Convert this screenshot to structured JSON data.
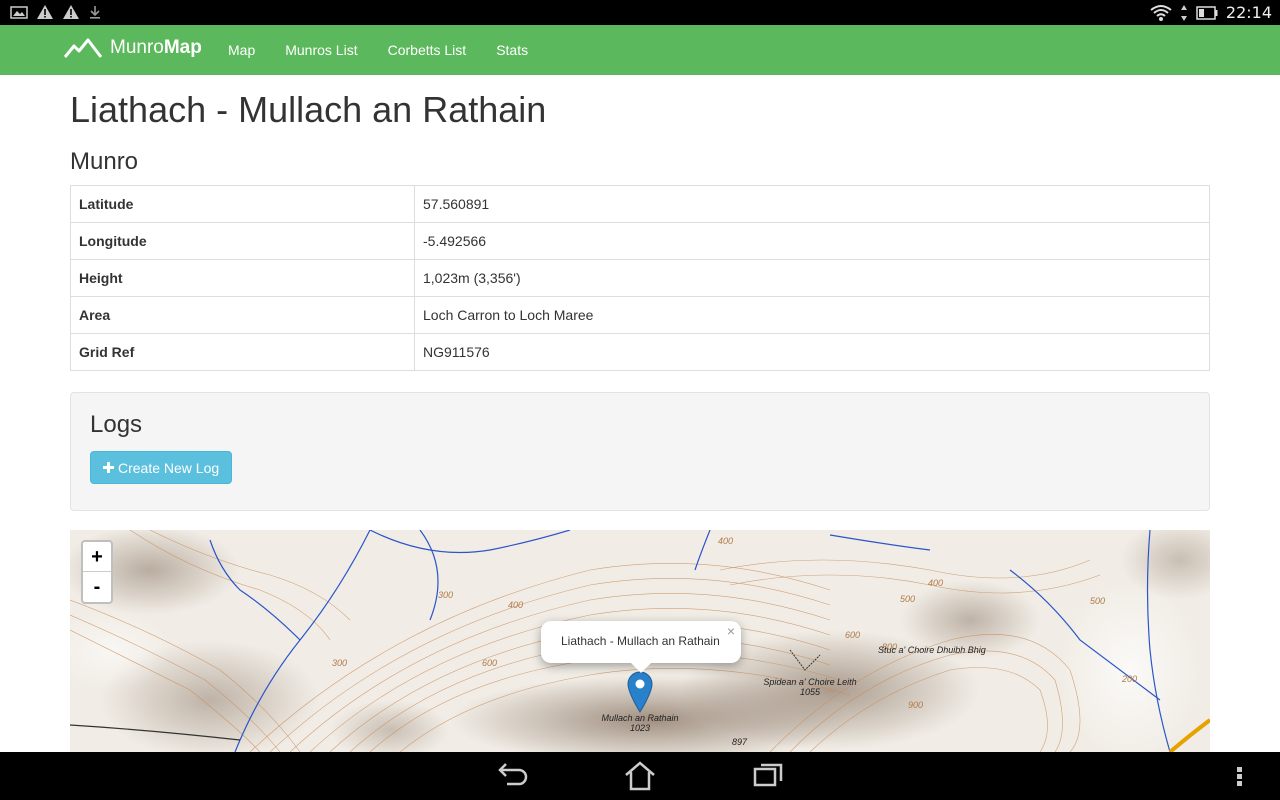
{
  "status_bar": {
    "time": "22:14",
    "icons_left": [
      "image-notification-icon",
      "warning-icon",
      "warning-icon",
      "download-icon"
    ],
    "icons_right": [
      "wifi-icon",
      "data-arrows-icon",
      "battery-icon"
    ]
  },
  "navbar": {
    "brand_light": "Munro",
    "brand_bold": "Map",
    "links": [
      "Map",
      "Munros List",
      "Corbetts List",
      "Stats"
    ],
    "color": "#5cb85c"
  },
  "page": {
    "title": "Liathach - Mullach an Rathain",
    "subtitle": "Munro"
  },
  "details": [
    {
      "key": "Latitude",
      "value": "57.560891"
    },
    {
      "key": "Longitude",
      "value": "-5.492566"
    },
    {
      "key": "Height",
      "value": "1,023m (3,356')"
    },
    {
      "key": "Area",
      "value": "Loch Carron to Loch Maree"
    },
    {
      "key": "Grid Ref",
      "value": "NG911576"
    }
  ],
  "logs": {
    "heading": "Logs",
    "create_button": "Create New Log",
    "button_color": "#5bc0de"
  },
  "map": {
    "zoom_in": "+",
    "zoom_out": "-",
    "popup_text": "Liathach - Mullach an Rathain",
    "popup_close": "×",
    "labels": {
      "mullach_name": "Mullach an Rathain",
      "mullach_height": "1023",
      "spidean_name": "Spidean a' Choire Leith",
      "spidean_height": "1055",
      "stuc_name": "Stuc a' Choire Dhuibh Bhig",
      "spot_897": "897",
      "contours": [
        "400",
        "300",
        "400",
        "500",
        "600",
        "800",
        "900",
        "400",
        "500",
        "200",
        "300",
        "600"
      ]
    }
  }
}
